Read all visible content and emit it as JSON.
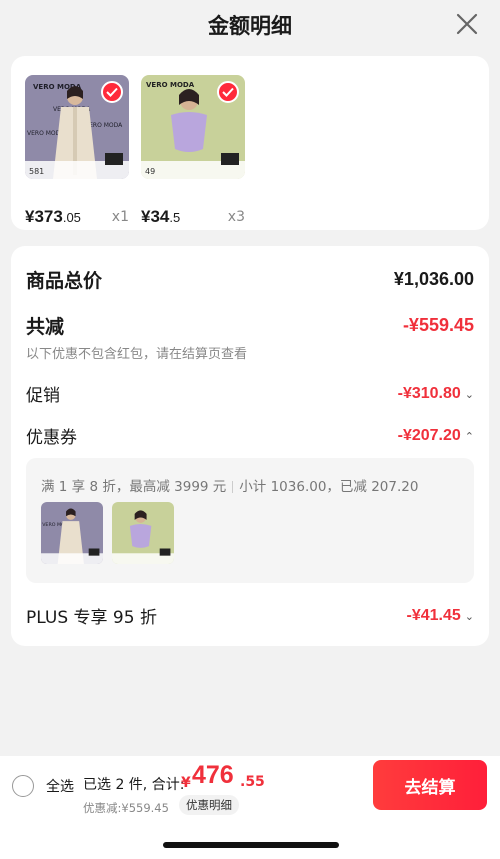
{
  "header": {
    "title": "金额明细"
  },
  "products": [
    {
      "brand": "VERO MODA",
      "price_int": "¥373",
      "price_dec": ".05",
      "qty": "x1",
      "tag_price": "581",
      "bg": "#8f8aa8",
      "garment": "#e9dfcd"
    },
    {
      "brand": "VERO MODA",
      "price_int": "¥34",
      "price_dec": ".5",
      "qty": "x3",
      "tag_price": "49",
      "bg": "#c8d19a",
      "garment": "#b9a6dd"
    }
  ],
  "summary": {
    "goods_total_label": "商品总价",
    "goods_total_value": "¥1,036.00",
    "discount_label": "共减",
    "discount_value": "-¥559.45",
    "discount_note": "以下优惠不包含红包，请在结算页查看",
    "promo_label": "促销",
    "promo_value": "-¥310.80",
    "coupon_label": "优惠券",
    "coupon_value": "-¥207.20",
    "coupon_desc_a": "满 1 享 8 折，最高减 3999 元",
    "coupon_desc_b": "小计 1036.00，已减 207.20",
    "plus_label": "PLUS 专享 95 折",
    "plus_value": "-¥41.45"
  },
  "bottom": {
    "select_all": "全选",
    "selected_text": "已选 2 件, 合计:",
    "currency": "¥",
    "total_int": "476",
    "total_dec": ".55",
    "discount_note": "优惠减:¥559.45",
    "detail_chip": "优惠明细",
    "checkout": "去结算"
  },
  "colors": {
    "accent": "#f0303b",
    "checkout": "#ff2a3b"
  }
}
